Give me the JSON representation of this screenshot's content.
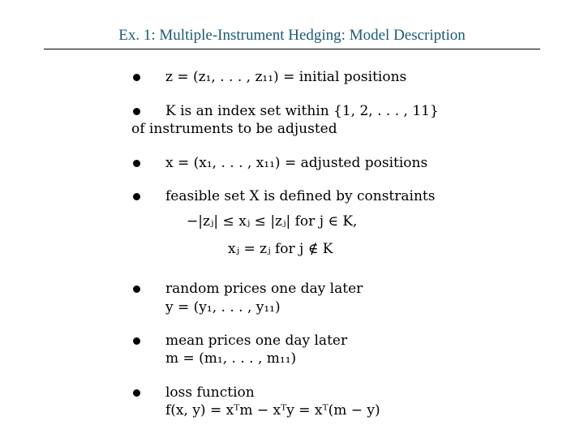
{
  "slide": {
    "title": "Ex. 1: Multiple-Instrument Hedging: Model Description"
  },
  "bullets": [
    {
      "lines": [
        "z = (z₁, . . . , z₁₁) = initial positions"
      ]
    },
    {
      "lines": [
        "K is an index set within {1, 2, . . . , 11}",
        "of instruments to be adjusted"
      ]
    },
    {
      "lines": [
        "x = (x₁, . . . , x₁₁) = adjusted positions"
      ]
    },
    {
      "lines": [
        "feasible set X is defined by constraints"
      ],
      "equations": [
        "−|zⱼ| ≤ xⱼ ≤ |zⱼ|    for j ∈ K,",
        "xⱼ = zⱼ    for j ∉ K"
      ]
    },
    {
      "lines": [
        "random prices one day later",
        "y = (y₁, . . . , y₁₁)"
      ]
    },
    {
      "lines": [
        "mean prices one day later",
        "m = (m₁, . . . , m₁₁)"
      ]
    },
    {
      "lines": [
        "loss function",
        "f(x, y) = xᵀm − xᵀy = xᵀ(m − y)"
      ]
    }
  ]
}
